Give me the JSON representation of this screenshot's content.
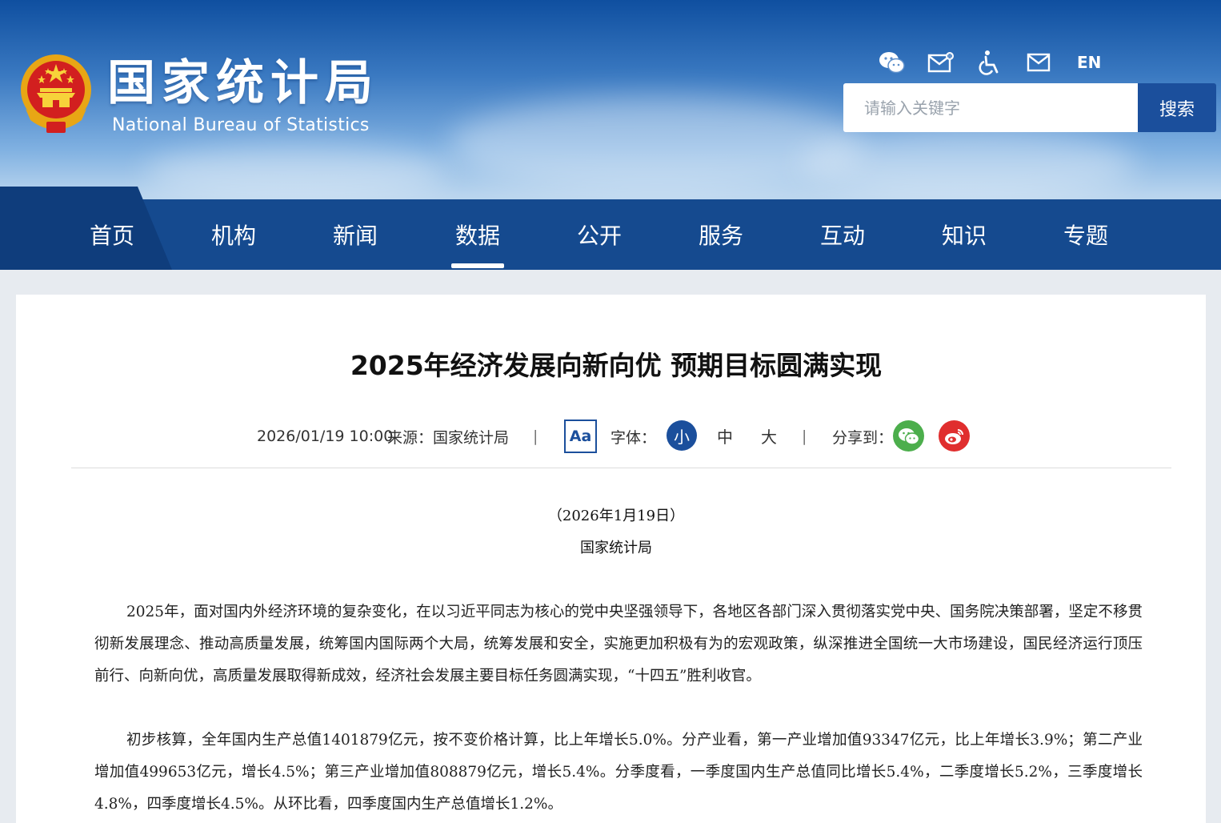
{
  "header": {
    "site_title": "国家统计局",
    "site_subtitle": "National Bureau of Statistics",
    "icons": [
      "wechat-icon",
      "mail-subscribe-icon",
      "accessibility-icon",
      "mail-icon"
    ],
    "language_link": "EN",
    "search": {
      "placeholder": "请输入关键字",
      "value": "",
      "button_label": "搜索"
    }
  },
  "nav": {
    "active": "数据",
    "items": [
      {
        "label": "首页"
      },
      {
        "label": "机构"
      },
      {
        "label": "新闻"
      },
      {
        "label": "数据"
      },
      {
        "label": "公开"
      },
      {
        "label": "服务"
      },
      {
        "label": "互动"
      },
      {
        "label": "知识"
      },
      {
        "label": "专题"
      }
    ]
  },
  "article": {
    "title": "2025年经济发展向新向优 预期目标圆满实现",
    "date": "2026/01/19 10:00",
    "source_label": "来源：",
    "source": "国家统计局",
    "separator": "|",
    "font_toggle_label": "Aa",
    "font_label": "字体：",
    "font_sizes": [
      "小",
      "中",
      "大"
    ],
    "font_size_selected": "小",
    "share_label": "分享到：",
    "share_targets": [
      "wechat-share-icon",
      "weibo-share-icon"
    ],
    "date_line": "（2026年1月19日）",
    "author_line": "国家统计局",
    "paragraphs": [
      "2025年，面对国内外经济环境的复杂变化，在以习近平同志为核心的党中央坚强领导下，各地区各部门深入贯彻落实党中央、国务院决策部署，坚定不移贯彻新发展理念、推动高质量发展，统筹国内国际两个大局，统筹发展和安全，实施更加积极有为的宏观政策，纵深推进全国统一大市场建设，国民经济运行顶压前行、向新向优，高质量发展取得新成效，经济社会发展主要目标任务圆满实现，“十四五”胜利收官。",
      "初步核算，全年国内生产总值1401879亿元，按不变价格计算，比上年增长5.0%。分产业看，第一产业增加值93347亿元，比上年增长3.9%；第二产业增加值499653亿元，增长4.5%；第三产业增加值808879亿元，增长5.4%。分季度看，一季度国内生产总值同比增长5.4%，二季度增长5.2%，三季度增长4.8%，四季度增长4.5%。从环比看，四季度国内生产总值增长1.2%。"
    ]
  },
  "colors": {
    "brand_blue": "#1b4f9c",
    "nav_blue": "#154a8f",
    "wechat_green": "#4cae4c",
    "weibo_red": "#e02e2e"
  }
}
